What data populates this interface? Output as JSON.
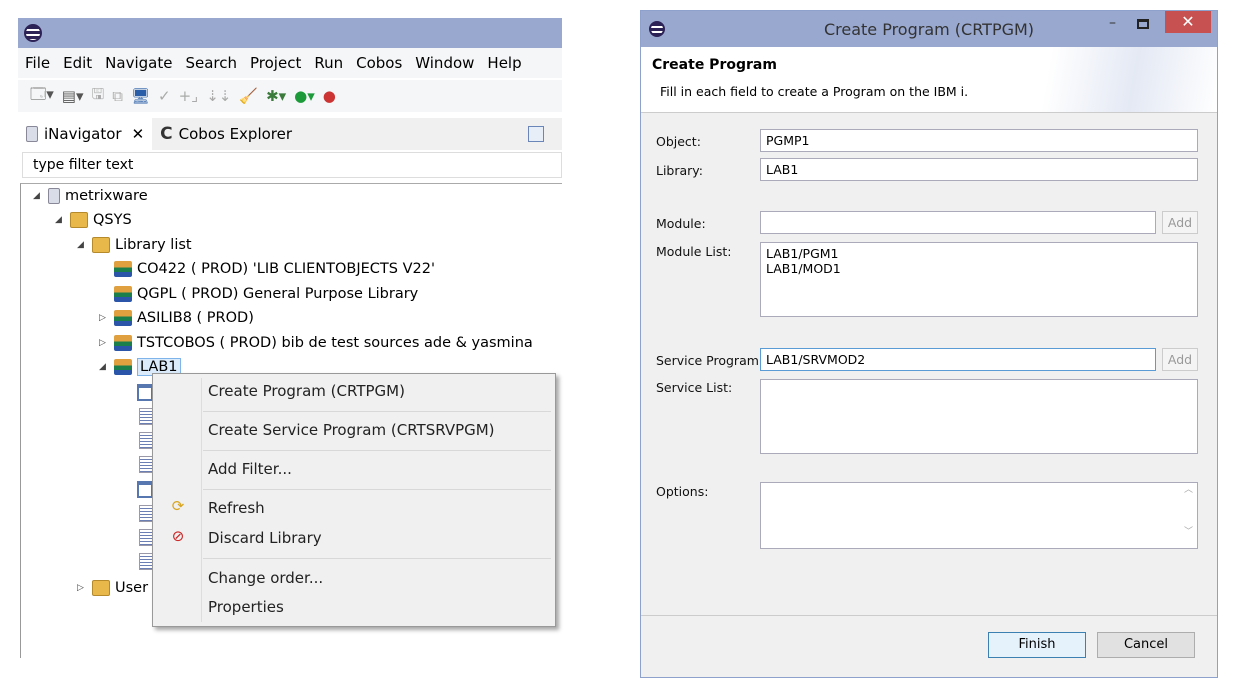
{
  "ide": {
    "menu": [
      "File",
      "Edit",
      "Navigate",
      "Search",
      "Project",
      "Run",
      "Cobos",
      "Window",
      "Help"
    ],
    "tabs": [
      {
        "label": "iNavigator",
        "icon": "server-icon",
        "closable": true
      },
      {
        "label": "Cobos Explorer",
        "icon": "cobos-icon"
      }
    ],
    "filter_placeholder": "type filter text",
    "tree": {
      "root": "metrixware",
      "qsys": "QSYS",
      "library_list": "Library list",
      "libraries": [
        "CO422 ( PROD) 'LIB CLIENTOBJECTS V22'",
        "QGPL ( PROD) General Purpose Library",
        "ASILIB8 ( PROD)",
        "TSTCOBOS ( PROD) bib de test sources ade & yasmina",
        "LAB1"
      ],
      "user": "User"
    }
  },
  "context_menu": {
    "items": [
      "Create Program (CRTPGM)",
      "Create Service Program (CRTSRVPGM)",
      "Add Filter...",
      "Refresh",
      "Discard Library",
      "Change order...",
      "Properties"
    ]
  },
  "dialog": {
    "title": "Create Program (CRTPGM)",
    "header_title": "Create Program",
    "header_desc": "Fill in each field to create a Program on the IBM i.",
    "labels": {
      "object": "Object:",
      "library": "Library:",
      "module": "Module:",
      "module_list": "Module List:",
      "service_program": "Service Program:",
      "service_list": "Service List:",
      "options": "Options:"
    },
    "values": {
      "object": "PGMP1",
      "library": "LAB1",
      "module": "",
      "module_list": [
        "LAB1/PGM1",
        "LAB1/MOD1"
      ],
      "service_program": "LAB1/SRVMOD2"
    },
    "add_label": "Add",
    "finish": "Finish",
    "cancel": "Cancel"
  },
  "colors": {
    "titlebar": "#99a8cf",
    "close": "#c75050"
  }
}
